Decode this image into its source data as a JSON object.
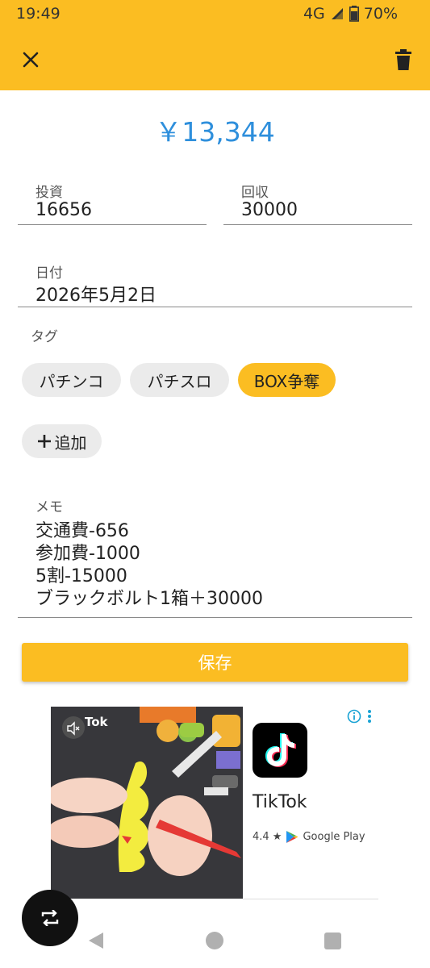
{
  "status_bar": {
    "time": "19:49",
    "network": "4G",
    "battery": "70%"
  },
  "app_bar": {
    "close_icon": "close-icon",
    "delete_icon": "trash-icon",
    "color": "#fbbd22"
  },
  "summary": {
    "amount": "￥13,344"
  },
  "form": {
    "investment": {
      "label": "投資",
      "value": "16656"
    },
    "recovery": {
      "label": "回収",
      "value": "30000"
    },
    "date": {
      "label": "日付",
      "value": "2026年5月2日"
    },
    "tags": {
      "label": "タグ",
      "items": [
        {
          "label": "パチンコ",
          "selected": false
        },
        {
          "label": "パチスロ",
          "selected": false
        },
        {
          "label": "BOX争奪",
          "selected": true
        }
      ],
      "add_label": "追加"
    },
    "memo": {
      "label": "メモ",
      "lines": [
        "交通費-656",
        "参加費-1000",
        "5割-15000",
        "ブラックボルト1箱＋30000"
      ]
    },
    "save_label": "保存"
  },
  "ad": {
    "video_watermark": "Tok",
    "app_name": "TikTok",
    "rating": "4.4 ★",
    "store": "Google Play"
  }
}
